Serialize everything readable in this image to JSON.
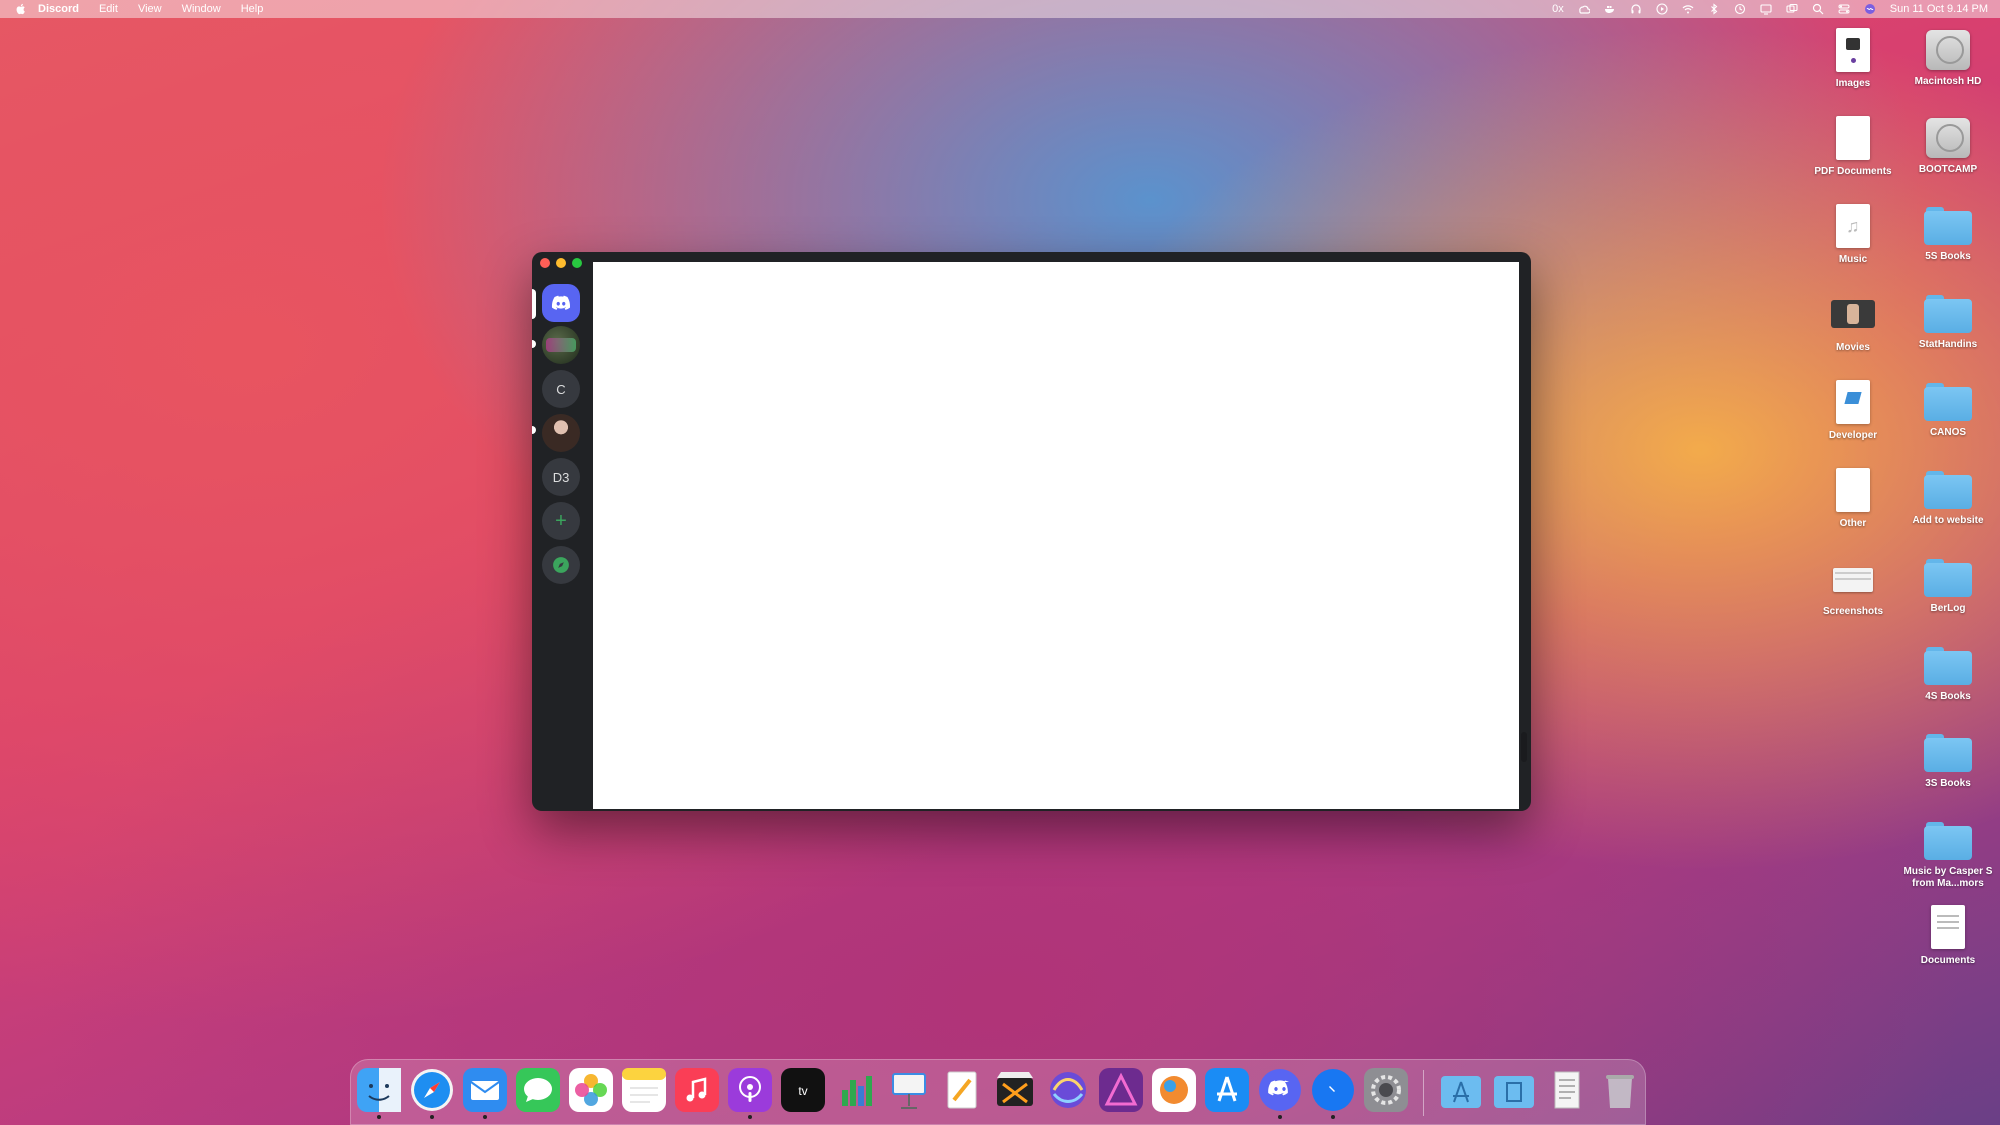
{
  "menubar": {
    "app_name": "Discord",
    "menus": [
      "Edit",
      "View",
      "Window",
      "Help"
    ],
    "clock": "Sun 11 Oct  9.14 PM",
    "status_text": "0x"
  },
  "desktop": {
    "icons": [
      {
        "label": "Images"
      },
      {
        "label": "Macintosh HD"
      },
      {
        "label": "PDF Documents"
      },
      {
        "label": "BOOTCAMP"
      },
      {
        "label": "Music"
      },
      {
        "label": "5S Books"
      },
      {
        "label": "Movies"
      },
      {
        "label": "StatHandins"
      },
      {
        "label": "Developer"
      },
      {
        "label": "CANOS"
      },
      {
        "label": "Other"
      },
      {
        "label": "Add to website"
      },
      {
        "label": "Screenshots"
      },
      {
        "label": "BerLog"
      },
      {
        "label": "4S Books"
      },
      {
        "label": "3S Books"
      },
      {
        "label": "Music by Casper S from Ma...mors"
      },
      {
        "label": "Documents"
      }
    ]
  },
  "discord": {
    "guilds": [
      {
        "label": "C"
      },
      {
        "label": "D3"
      }
    ],
    "add_symbol": "+"
  },
  "colors": {
    "discord_blurple": "#5865f2",
    "discord_dark": "#202225",
    "discord_green": "#3ba55d"
  }
}
